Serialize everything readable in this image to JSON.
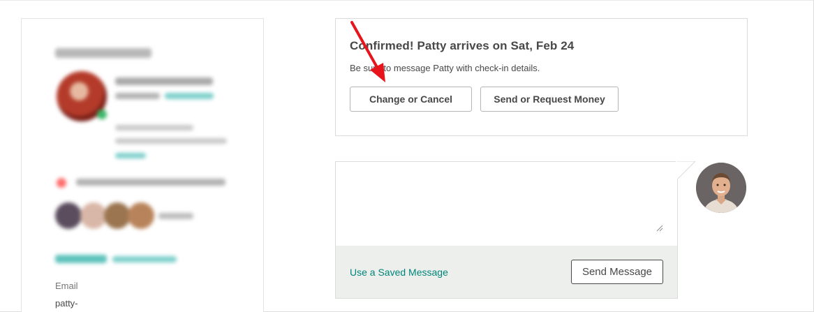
{
  "profile_panel": {
    "email_label": "Email",
    "email_value": "patty-"
  },
  "confirmation": {
    "title": "Confirmed! Patty arrives on Sat, Feb 24",
    "subtitle": "Be sure to message Patty with check-in details.",
    "change_button": "Change or Cancel",
    "money_button": "Send or Request Money"
  },
  "composer": {
    "message_value": "",
    "saved_message_link": "Use a Saved Message",
    "send_button": "Send Message"
  },
  "colors": {
    "link_teal": "#00847a",
    "annotation_red": "#e8141b",
    "footer_bg": "#edefec"
  },
  "icons": {
    "host_avatar": "host-avatar",
    "annotation": "red-arrow"
  }
}
